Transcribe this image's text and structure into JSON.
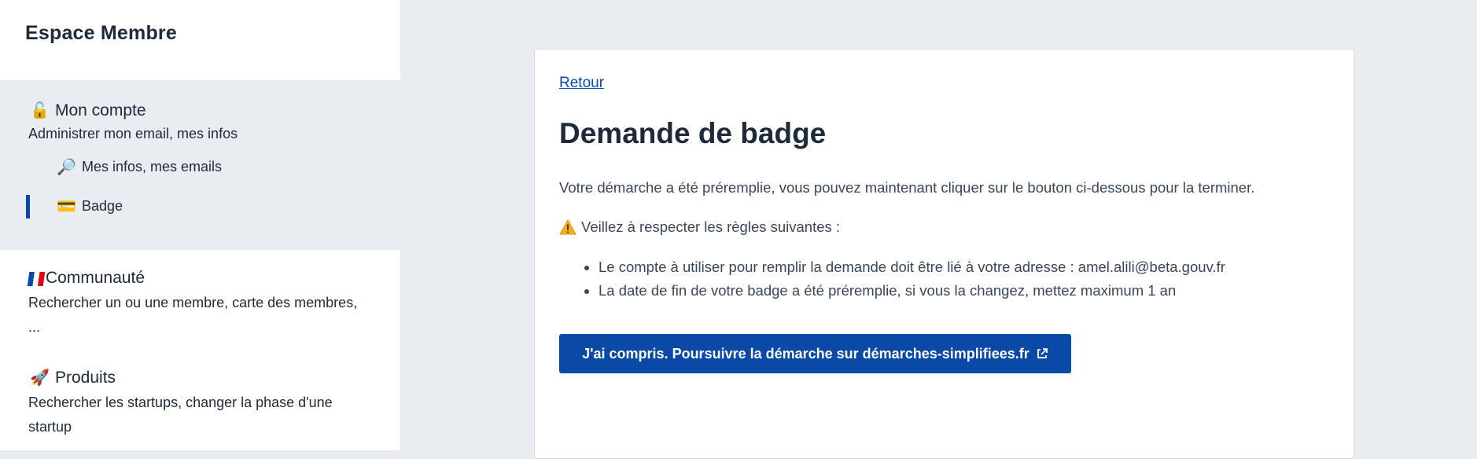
{
  "sidebar": {
    "brand": "Espace Membre",
    "account": {
      "icon": "🔓",
      "title": "Mon compte",
      "description": "Administrer mon email, mes infos",
      "items": [
        {
          "icon": "🔎",
          "label": "Mes infos, mes emails"
        },
        {
          "icon": "💳",
          "label": "Badge",
          "active": true
        }
      ]
    },
    "community": {
      "title": "Communauté",
      "description_line1": "Rechercher un ou une membre, carte des membres,",
      "description_line2": "..."
    },
    "products": {
      "icon": "🚀",
      "title": "Produits",
      "description_line1": "Rechercher les startups, changer la phase d'une",
      "description_line2": "startup"
    }
  },
  "main": {
    "back_label": "Retour",
    "title": "Demande de badge",
    "intro": "Votre démarche a été préremplie, vous pouvez maintenant cliquer sur le bouton ci-dessous pour la terminer.",
    "warning": "Veillez à respecter les règles suivantes :",
    "rules": [
      "Le compte à utiliser pour remplir la demande doit être lié à votre adresse : amel.alili@beta.gouv.fr",
      "La date de fin de votre badge a été préremplie, si vous la changez, mettez maximum 1 an"
    ],
    "cta_label": "J'ai compris. Poursuivre la démarche sur démarches-simplifiees.fr"
  },
  "colors": {
    "accent": "#0a4aa6",
    "sidebar_section_bg": "#e9ecf1",
    "page_bg": "#e9ecf1"
  }
}
